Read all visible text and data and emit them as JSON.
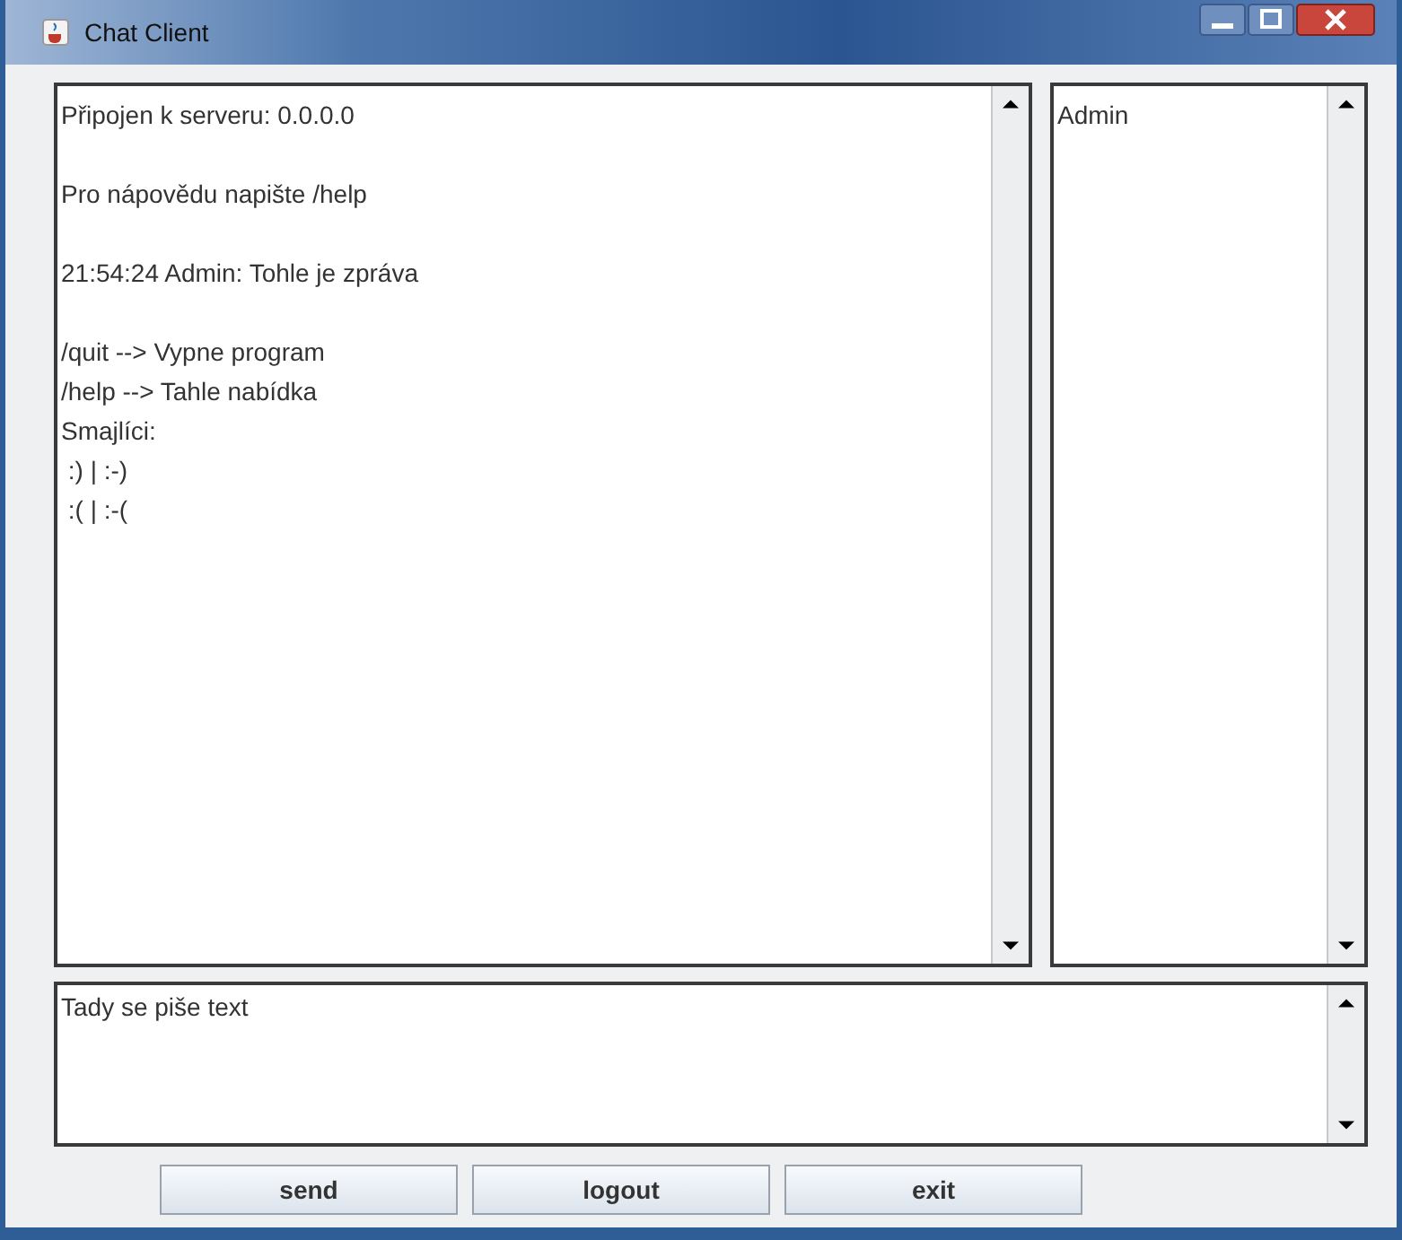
{
  "window": {
    "title": "Chat Client"
  },
  "chat_log": {
    "blocks": [
      {
        "lines": [
          "Připojen k serveru: 0.0.0.0"
        ]
      },
      {
        "lines": [
          "Pro nápovědu napište /help"
        ]
      },
      {
        "lines": [
          "21:54:24 Admin: Tohle je zpráva"
        ]
      },
      {
        "lines": [
          "/quit --> Vypne program",
          "/help --> Tahle nabídka",
          "Smajlíci:",
          " :) | :-)",
          " :( | :-("
        ]
      }
    ]
  },
  "users": [
    "Admin"
  ],
  "message_input": {
    "value": "Tady se piše text"
  },
  "buttons": [
    "send",
    "logout",
    "exit"
  ]
}
